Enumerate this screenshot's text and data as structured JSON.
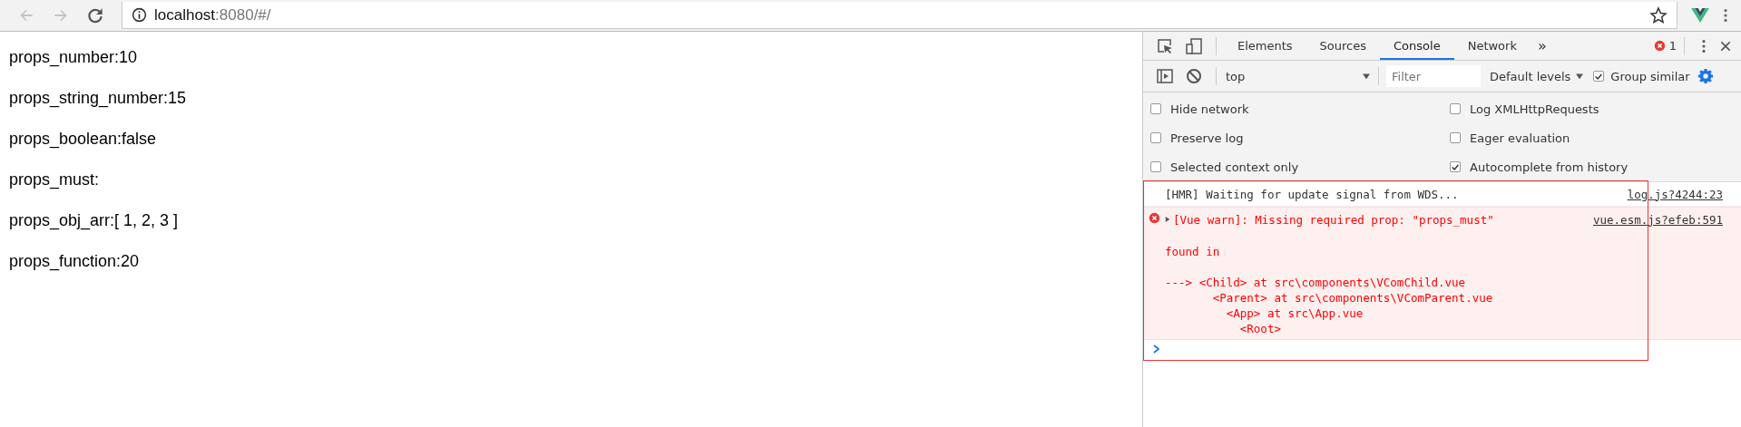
{
  "browser": {
    "address_host": "localhost",
    "address_rest": ":8080/#/",
    "back_disabled": true,
    "forward_disabled": true
  },
  "page": {
    "lines": [
      "props_number:10",
      "props_string_number:15",
      "props_boolean:false",
      "props_must:",
      "props_obj_arr:[ 1, 2, 3 ]",
      "props_function:20"
    ]
  },
  "devtools": {
    "tabs": [
      {
        "label": "Elements",
        "selected": false
      },
      {
        "label": "Sources",
        "selected": false
      },
      {
        "label": "Console",
        "selected": true
      },
      {
        "label": "Network",
        "selected": false
      }
    ],
    "more_tabs": "»",
    "error_count": "1",
    "context": "top",
    "filter": {
      "placeholder": "Filter"
    },
    "levels": "Default levels",
    "group_similar": {
      "label": "Group similar",
      "checked": true
    },
    "settings": [
      {
        "label": "Hide network",
        "checked": false
      },
      {
        "label": "Log XMLHttpRequests",
        "checked": false
      },
      {
        "label": "Preserve log",
        "checked": false
      },
      {
        "label": "Eager evaluation",
        "checked": false
      },
      {
        "label": "Selected context only",
        "checked": false
      },
      {
        "label": "Autocomplete from history",
        "checked": true
      }
    ],
    "messages": [
      {
        "kind": "log",
        "text": "[HMR] Waiting for update signal from WDS...",
        "source": "log.js?4244:23"
      },
      {
        "kind": "error",
        "text": "[Vue warn]: Missing required prop: \"props_must\"",
        "source": "vue.esm.js?efeb:591",
        "details": [
          "found in",
          "---> <Child> at src\\components\\VComChild.vue",
          "       <Parent> at src\\components\\VComParent.vue",
          "         <App> at src\\App.vue",
          "           <Root>"
        ]
      }
    ],
    "highlight": true
  }
}
